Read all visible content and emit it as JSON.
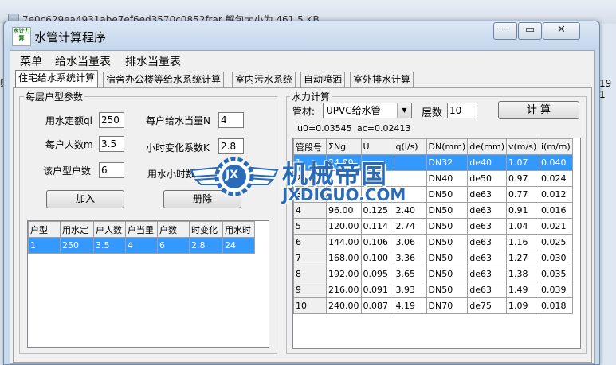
{
  "background": {
    "file_line": "7e0c629ea4931abe7ef6ed3570c0852frar  解包大小为 461.5 KB",
    "right_edge_text": "19 1",
    "left_edge_text": "贼"
  },
  "window": {
    "icon_text": "水计力算",
    "title": "水管计算程序",
    "controls": {
      "minimize": "─",
      "maximize": "▭",
      "close": "✕"
    }
  },
  "menu": [
    "菜单",
    "给水当量表",
    "排水当量表"
  ],
  "tabs": [
    "住宅给水系统计算",
    "宿舍办公楼等给水系统计算",
    "室内污水系统",
    "自动喷洒",
    "室外排水计算"
  ],
  "left": {
    "group_title": "每层户型参数",
    "fields": {
      "quota_label": "用水定额ql",
      "quota_value": "250",
      "people_label": "每户人数m",
      "people_value": "3.5",
      "households_label": "该户型户数",
      "households_value": "6",
      "fixture_units_label": "每户给水当量N",
      "fixture_units_value": "4",
      "hourly_factor_label": "小时变化系数K",
      "hourly_factor_value": "2.8",
      "hours_label": "用水小时数",
      "hours_value": ""
    },
    "add_button": "加入",
    "delete_button": "册除",
    "table": {
      "headers": [
        "户型",
        "用水定",
        "户人数",
        "户当里",
        "户数",
        "时变化",
        "用水时"
      ],
      "rows": [
        [
          "1",
          "250",
          "3.5",
          "4",
          "6",
          "2.8",
          "24"
        ]
      ]
    }
  },
  "right": {
    "group_title": "水力计算",
    "pipe_material_label": "管材:",
    "pipe_material_value": "UPVC给水管",
    "floors_label": "层数",
    "floors_value": "10",
    "calc_button": "计  算",
    "u0_text": "u0=0.03545",
    "ac_text": "ac=0.02413",
    "table": {
      "headers": [
        "管段号",
        "ΣNg",
        "U",
        "q(l/s)",
        "DN(mm)",
        "de(mm)",
        "v(m/s)",
        "i(m/m)"
      ],
      "rows": [
        [
          "1",
          "24.00",
          "",
          "",
          "DN32",
          "de40",
          "1.07",
          "0.040"
        ],
        [
          "2",
          "",
          "",
          "",
          "DN40",
          "de50",
          "0.97",
          "0.024"
        ],
        [
          "3",
          "",
          "",
          "",
          "DN50",
          "de63",
          "0.77",
          "0.012"
        ],
        [
          "4",
          "96.00",
          "0.125",
          "2.40",
          "DN50",
          "de63",
          "0.91",
          "0.016"
        ],
        [
          "5",
          "120.00",
          "0.114",
          "2.74",
          "DN50",
          "de63",
          "1.04",
          "0.021"
        ],
        [
          "6",
          "144.00",
          "0.106",
          "3.06",
          "DN50",
          "de63",
          "1.16",
          "0.025"
        ],
        [
          "7",
          "168.00",
          "0.100",
          "3.36",
          "DN50",
          "de63",
          "1.27",
          "0.030"
        ],
        [
          "8",
          "192.00",
          "0.095",
          "3.65",
          "DN50",
          "de63",
          "1.38",
          "0.035"
        ],
        [
          "9",
          "216.00",
          "0.091",
          "3.93",
          "DN50",
          "de63",
          "1.49",
          "0.039"
        ],
        [
          "10",
          "240.00",
          "0.087",
          "4.19",
          "DN70",
          "de75",
          "1.09",
          "0.018"
        ]
      ]
    }
  },
  "watermark": {
    "title": "机械帝国",
    "url": "JXDIGUO.COM",
    "logo_text": "JX"
  },
  "colors": {
    "selection": "#3399ff",
    "watermark": "#2a6bb8",
    "window_frame": "#c9d9ec"
  }
}
